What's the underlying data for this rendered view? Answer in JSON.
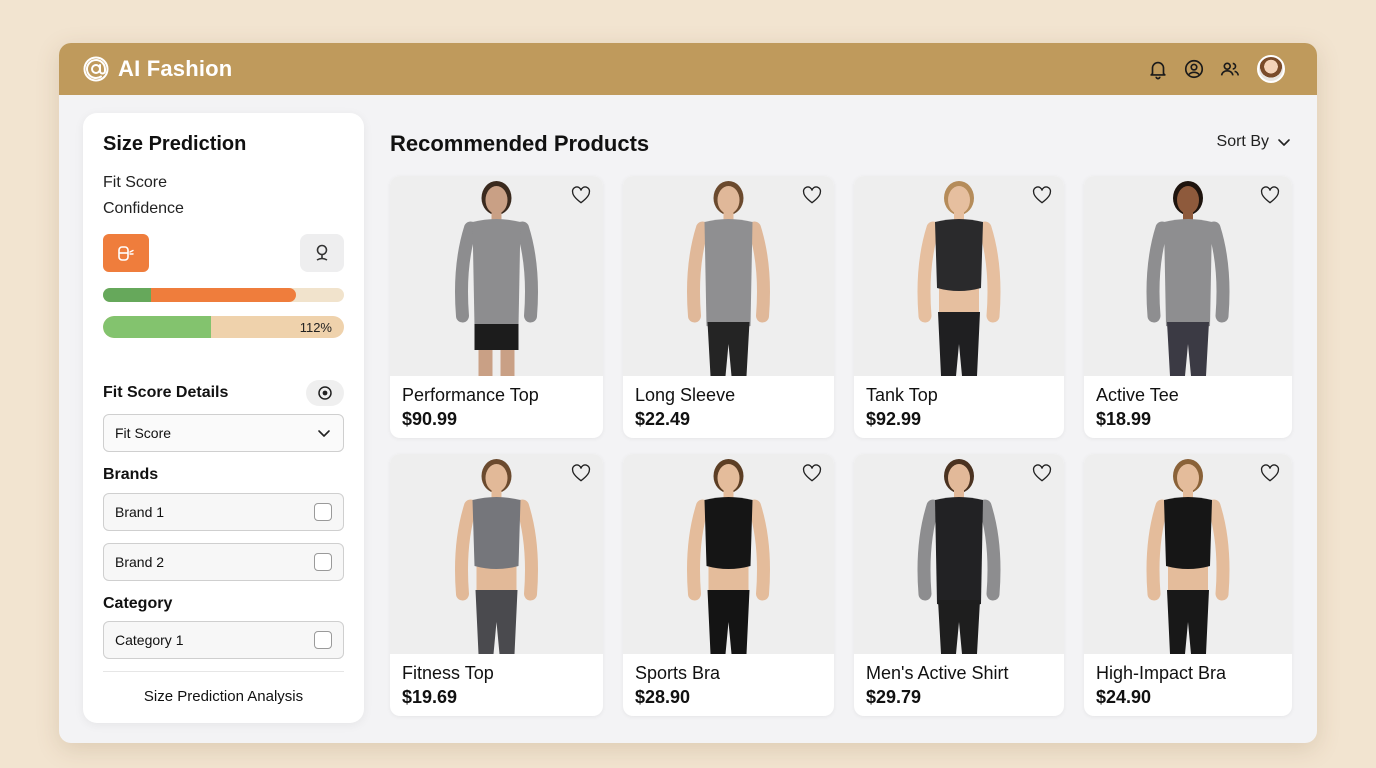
{
  "app": {
    "title": "AI Fashion"
  },
  "topbar": {
    "icons": [
      "bell-icon",
      "account-circle-icon",
      "users-icon"
    ],
    "avatar": "user-avatar"
  },
  "sidebar": {
    "title": "Size Prediction",
    "line1": "Fit Score",
    "line2": "Confidence",
    "buttons": [
      "size-scan-icon",
      "location-pin-icon"
    ],
    "fit_bar": {
      "green_fraction": 0.2,
      "orange_fraction": 0.6
    },
    "confidence_bar": {
      "fraction": 0.45,
      "label": "112%"
    },
    "details": {
      "title": "Fit Score Details",
      "select_value": "Fit Score"
    },
    "brands": {
      "title": "Brands",
      "items": [
        {
          "label": "Brand 1"
        },
        {
          "label": "Brand 2"
        }
      ]
    },
    "category": {
      "title": "Category",
      "items": [
        {
          "label": "Category 1"
        }
      ]
    },
    "footer": "Size Prediction Analysis"
  },
  "main": {
    "title": "Recommended Products",
    "sort_label": "Sort By",
    "products": [
      {
        "name": "Performance Top",
        "price": "$90.99"
      },
      {
        "name": "Long Sleeve",
        "price": "$22.49"
      },
      {
        "name": "Tank Top",
        "price": "$92.99"
      },
      {
        "name": "Active Tee",
        "price": "$18.99"
      },
      {
        "name": "Fitness Top",
        "price": "$19.69"
      },
      {
        "name": "Sports Bra",
        "price": "$28.90"
      },
      {
        "name": "Men's Active Shirt",
        "price": "$29.79"
      },
      {
        "name": "High-Impact Bra",
        "price": "$24.90"
      }
    ]
  },
  "colors": {
    "topbar": "#bf9a5c",
    "accent_orange": "#ef7d3c",
    "bar_green": "#66a85b",
    "bar_light_green": "#83c36e",
    "bar_track": "#f1e3cc",
    "background": "#f2e4d0"
  }
}
